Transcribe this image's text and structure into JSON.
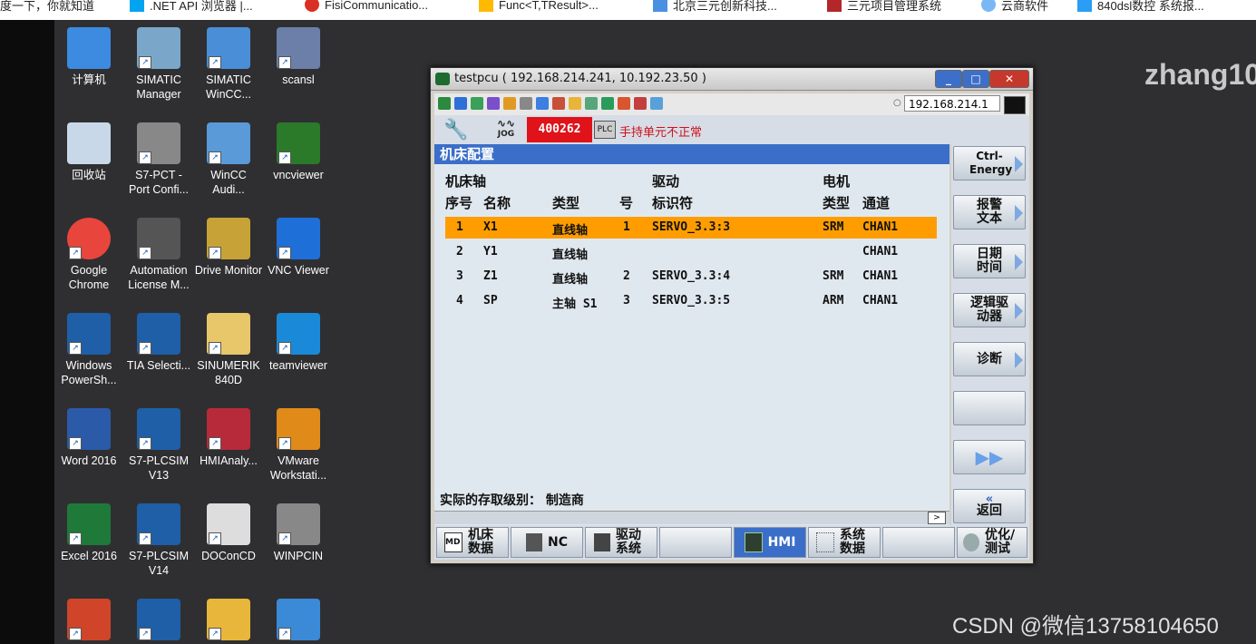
{
  "browser": {
    "bookmarks": [
      "度一下，你就知道",
      ".NET API 浏览器 |...",
      "FisiCommunicatio...",
      "Func<T,TResult>...",
      "北京三元创新科技...",
      "三元项目管理系统",
      "云商软件",
      "840dsl数控 系统报..."
    ]
  },
  "desktop": {
    "icons": [
      [
        "计算机",
        "SIMATIC Manager",
        "SIMATIC WinCC...",
        "scansl"
      ],
      [
        "回收站",
        "S7-PCT - Port Confi...",
        "WinCC Audi...",
        "vncviewer"
      ],
      [
        "Google Chrome",
        "Automation License M...",
        "Drive Monitor",
        "VNC Viewer"
      ],
      [
        "Windows PowerSh...",
        "TIA Selecti...",
        "SINUMERIK 840D",
        "teamviewer"
      ],
      [
        "Word 2016",
        "S7-PLCSIM V13",
        "HMIAnaly...",
        "VMware Workstati..."
      ],
      [
        "Excel 2016",
        "S7-PLCSIM V14",
        "DOConCD",
        "WINPCIN"
      ]
    ],
    "overlay_user": "zhang10",
    "watermark": "CSDN @微信13758104650"
  },
  "window": {
    "title": "testpcu ( 192.168.214.241, 10.192.23.50 )",
    "ip_field": "192.168.214.1",
    "header": {
      "mode": "JOG",
      "alarm_number": "400262",
      "plc_tag": "PLC",
      "alarm_text": "手持单元不正常"
    },
    "panel": {
      "title": "机床配置",
      "group_headers": {
        "axis": "机床轴",
        "drive": "驱动",
        "motor": "电机"
      },
      "columns": [
        "序号",
        "名称",
        "类型",
        "号",
        "标识符",
        "类型",
        "通道"
      ],
      "rows": [
        {
          "no": "1",
          "name": "X1",
          "type": "直线轴",
          "drive_no": "1",
          "ident": "SERVO_3.3:3",
          "motor": "SRM",
          "chan": "CHAN1"
        },
        {
          "no": "2",
          "name": "Y1",
          "type": "直线轴",
          "drive_no": "",
          "ident": "",
          "motor": "",
          "chan": "CHAN1"
        },
        {
          "no": "3",
          "name": "Z1",
          "type": "直线轴",
          "drive_no": "2",
          "ident": "SERVO_3.3:4",
          "motor": "SRM",
          "chan": "CHAN1"
        },
        {
          "no": "4",
          "name": "SP",
          "type": "主轴 S1",
          "drive_no": "3",
          "ident": "SERVO_3.3:5",
          "motor": "ARM",
          "chan": "CHAN1"
        }
      ],
      "access_level": "实际的存取级别： 制造商"
    },
    "softkeys_right": [
      "Ctrl-Energy",
      "报警文本",
      "日期时间",
      "逻辑驱动器",
      "诊断",
      "",
      "▶▶",
      "返回"
    ],
    "softkeys_bottom": [
      "机床数据",
      "NC",
      "驱动系统",
      "",
      "HMI",
      "系统数据",
      "",
      "优化/测试"
    ],
    "colors": {
      "selected_row": "#ff9d00",
      "panel_title": "#3a6ec8",
      "alarm": "#e0121a"
    }
  }
}
